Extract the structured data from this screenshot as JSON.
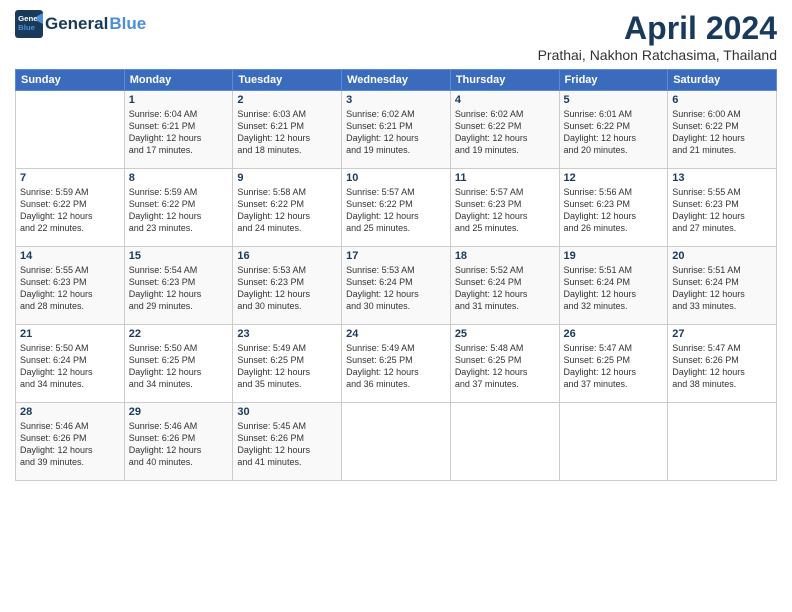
{
  "header": {
    "logo_line1": "General",
    "logo_line2": "Blue",
    "month_title": "April 2024",
    "subtitle": "Prathai, Nakhon Ratchasima, Thailand"
  },
  "weekdays": [
    "Sunday",
    "Monday",
    "Tuesday",
    "Wednesday",
    "Thursday",
    "Friday",
    "Saturday"
  ],
  "weeks": [
    [
      {
        "day": "",
        "info": ""
      },
      {
        "day": "1",
        "info": "Sunrise: 6:04 AM\nSunset: 6:21 PM\nDaylight: 12 hours\nand 17 minutes."
      },
      {
        "day": "2",
        "info": "Sunrise: 6:03 AM\nSunset: 6:21 PM\nDaylight: 12 hours\nand 18 minutes."
      },
      {
        "day": "3",
        "info": "Sunrise: 6:02 AM\nSunset: 6:21 PM\nDaylight: 12 hours\nand 19 minutes."
      },
      {
        "day": "4",
        "info": "Sunrise: 6:02 AM\nSunset: 6:22 PM\nDaylight: 12 hours\nand 19 minutes."
      },
      {
        "day": "5",
        "info": "Sunrise: 6:01 AM\nSunset: 6:22 PM\nDaylight: 12 hours\nand 20 minutes."
      },
      {
        "day": "6",
        "info": "Sunrise: 6:00 AM\nSunset: 6:22 PM\nDaylight: 12 hours\nand 21 minutes."
      }
    ],
    [
      {
        "day": "7",
        "info": "Sunrise: 5:59 AM\nSunset: 6:22 PM\nDaylight: 12 hours\nand 22 minutes."
      },
      {
        "day": "8",
        "info": "Sunrise: 5:59 AM\nSunset: 6:22 PM\nDaylight: 12 hours\nand 23 minutes."
      },
      {
        "day": "9",
        "info": "Sunrise: 5:58 AM\nSunset: 6:22 PM\nDaylight: 12 hours\nand 24 minutes."
      },
      {
        "day": "10",
        "info": "Sunrise: 5:57 AM\nSunset: 6:22 PM\nDaylight: 12 hours\nand 25 minutes."
      },
      {
        "day": "11",
        "info": "Sunrise: 5:57 AM\nSunset: 6:23 PM\nDaylight: 12 hours\nand 25 minutes."
      },
      {
        "day": "12",
        "info": "Sunrise: 5:56 AM\nSunset: 6:23 PM\nDaylight: 12 hours\nand 26 minutes."
      },
      {
        "day": "13",
        "info": "Sunrise: 5:55 AM\nSunset: 6:23 PM\nDaylight: 12 hours\nand 27 minutes."
      }
    ],
    [
      {
        "day": "14",
        "info": "Sunrise: 5:55 AM\nSunset: 6:23 PM\nDaylight: 12 hours\nand 28 minutes."
      },
      {
        "day": "15",
        "info": "Sunrise: 5:54 AM\nSunset: 6:23 PM\nDaylight: 12 hours\nand 29 minutes."
      },
      {
        "day": "16",
        "info": "Sunrise: 5:53 AM\nSunset: 6:23 PM\nDaylight: 12 hours\nand 30 minutes."
      },
      {
        "day": "17",
        "info": "Sunrise: 5:53 AM\nSunset: 6:24 PM\nDaylight: 12 hours\nand 30 minutes."
      },
      {
        "day": "18",
        "info": "Sunrise: 5:52 AM\nSunset: 6:24 PM\nDaylight: 12 hours\nand 31 minutes."
      },
      {
        "day": "19",
        "info": "Sunrise: 5:51 AM\nSunset: 6:24 PM\nDaylight: 12 hours\nand 32 minutes."
      },
      {
        "day": "20",
        "info": "Sunrise: 5:51 AM\nSunset: 6:24 PM\nDaylight: 12 hours\nand 33 minutes."
      }
    ],
    [
      {
        "day": "21",
        "info": "Sunrise: 5:50 AM\nSunset: 6:24 PM\nDaylight: 12 hours\nand 34 minutes."
      },
      {
        "day": "22",
        "info": "Sunrise: 5:50 AM\nSunset: 6:25 PM\nDaylight: 12 hours\nand 34 minutes."
      },
      {
        "day": "23",
        "info": "Sunrise: 5:49 AM\nSunset: 6:25 PM\nDaylight: 12 hours\nand 35 minutes."
      },
      {
        "day": "24",
        "info": "Sunrise: 5:49 AM\nSunset: 6:25 PM\nDaylight: 12 hours\nand 36 minutes."
      },
      {
        "day": "25",
        "info": "Sunrise: 5:48 AM\nSunset: 6:25 PM\nDaylight: 12 hours\nand 37 minutes."
      },
      {
        "day": "26",
        "info": "Sunrise: 5:47 AM\nSunset: 6:25 PM\nDaylight: 12 hours\nand 37 minutes."
      },
      {
        "day": "27",
        "info": "Sunrise: 5:47 AM\nSunset: 6:26 PM\nDaylight: 12 hours\nand 38 minutes."
      }
    ],
    [
      {
        "day": "28",
        "info": "Sunrise: 5:46 AM\nSunset: 6:26 PM\nDaylight: 12 hours\nand 39 minutes."
      },
      {
        "day": "29",
        "info": "Sunrise: 5:46 AM\nSunset: 6:26 PM\nDaylight: 12 hours\nand 40 minutes."
      },
      {
        "day": "30",
        "info": "Sunrise: 5:45 AM\nSunset: 6:26 PM\nDaylight: 12 hours\nand 41 minutes."
      },
      {
        "day": "",
        "info": ""
      },
      {
        "day": "",
        "info": ""
      },
      {
        "day": "",
        "info": ""
      },
      {
        "day": "",
        "info": ""
      }
    ]
  ]
}
